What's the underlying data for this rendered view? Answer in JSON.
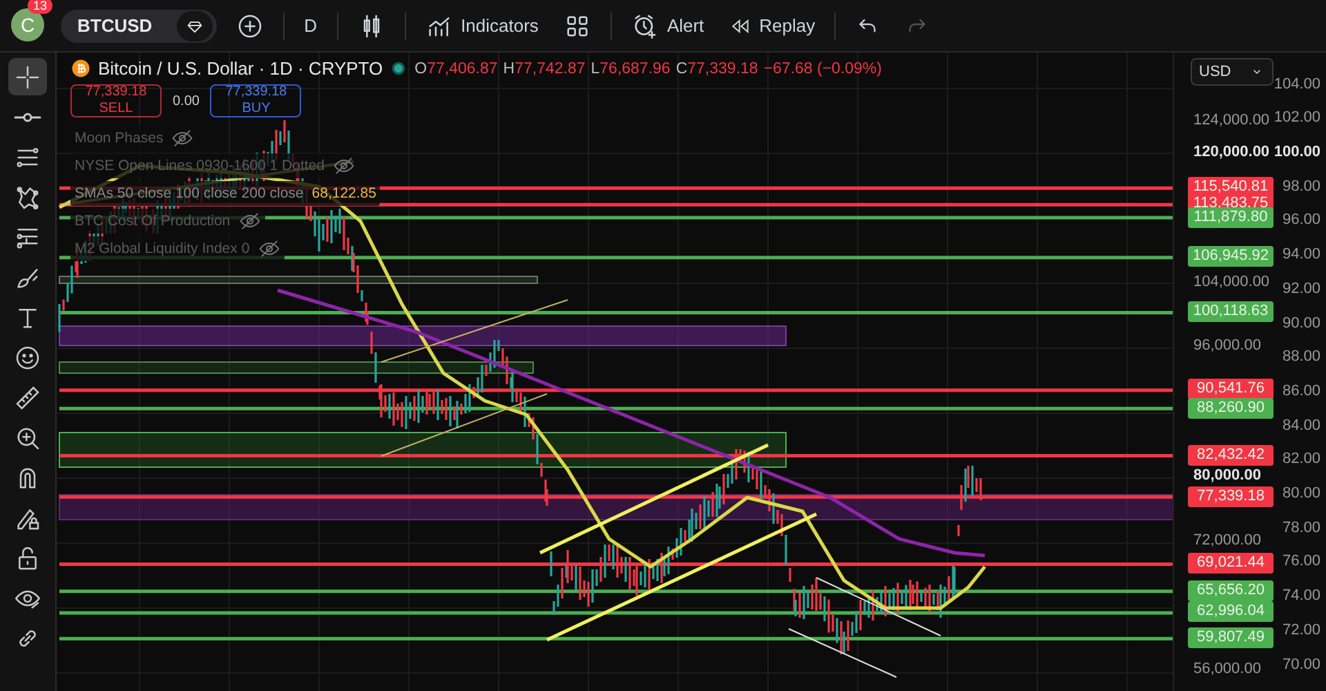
{
  "toolbar": {
    "avatar": "C",
    "badge": "13",
    "symbol": "BTCUSD",
    "interval": "D",
    "indicators": "Indicators",
    "alert": "Alert",
    "replay": "Replay",
    "redo_disabled": true
  },
  "tools": [
    {
      "kind": "crosshair",
      "selected": true
    },
    {
      "kind": "hline",
      "selected": false
    },
    {
      "kind": "channel",
      "selected": false
    },
    {
      "kind": "pattern",
      "selected": false
    },
    {
      "kind": "fib",
      "selected": false
    },
    {
      "kind": "brush",
      "selected": false
    },
    {
      "kind": "text",
      "selected": false
    },
    {
      "kind": "smiley",
      "selected": false
    },
    {
      "kind": "ruler",
      "selected": false
    },
    {
      "kind": "zoom",
      "selected": false
    },
    {
      "kind": "magnet",
      "selected": false
    },
    {
      "kind": "pencil-lock",
      "selected": false
    },
    {
      "kind": "lock",
      "selected": false
    },
    {
      "kind": "eye",
      "selected": false
    },
    {
      "kind": "link",
      "selected": false
    }
  ],
  "legend": {
    "title": "Bitcoin / U.S. Dollar · 1D · CRYPTO",
    "ohlc": [
      {
        "label": "O",
        "value": "77,406.87"
      },
      {
        "label": "H",
        "value": "77,742.87"
      },
      {
        "label": "L",
        "value": "76,687.96"
      },
      {
        "label": "C",
        "value": "77,339.18"
      }
    ],
    "change": "−67.68 (−0.09%)"
  },
  "trade": {
    "sell_price": "77,339.18",
    "sell_label": "SELL",
    "spread": "0.00",
    "buy_price": "77,339.18",
    "buy_label": "BUY"
  },
  "indicators": [
    {
      "name": "Moon Phases",
      "hidden": true
    },
    {
      "name": "NYSE Open Lines 0930-1600 1 Dotted",
      "hidden": true
    },
    {
      "name": "SMAs 50 close 100 close 200 close",
      "value": "68,122.85",
      "hidden": false
    },
    {
      "name": "BTC Cost Of Production",
      "hidden": true
    },
    {
      "name": "M2 Global Liquidity Index 0",
      "hidden": true
    }
  ],
  "currency": "USD",
  "price_axis": {
    "ticks": [
      {
        "label": "124,000.00",
        "strong": false
      },
      {
        "label": "120,000.00",
        "strong": true
      },
      {
        "label": "104,000.00",
        "strong": false
      },
      {
        "label": "96,000.00",
        "strong": false
      },
      {
        "label": "80,000.00",
        "strong": true
      },
      {
        "label": "72,000.00",
        "strong": false
      },
      {
        "label": "56,000.00",
        "strong": false
      }
    ],
    "levels": [
      {
        "label": "115,540.81",
        "color": "#f23645"
      },
      {
        "label": "113,483.75",
        "color": "#f23645"
      },
      {
        "label": "111,879.80",
        "color": "#4caf50"
      },
      {
        "label": "106,945.92",
        "color": "#4caf50"
      },
      {
        "label": "100,118.63",
        "color": "#4caf50"
      },
      {
        "label": "90,541.76",
        "color": "#f23645"
      },
      {
        "label": "88,260.90",
        "color": "#4caf50"
      },
      {
        "label": "82,432.42",
        "color": "#f23645"
      },
      {
        "label": "77,339.18",
        "color": "#f23645"
      },
      {
        "label": "69,021.44",
        "color": "#f23645"
      },
      {
        "label": "65,656.20",
        "color": "#4caf50"
      },
      {
        "label": "62,996.04",
        "color": "#4caf50"
      },
      {
        "label": "59,807.49",
        "color": "#4caf50"
      }
    ]
  },
  "percent_axis": {
    "ticks": [
      {
        "label": "104.00",
        "strong": false
      },
      {
        "label": "102.00",
        "strong": false
      },
      {
        "label": "100.00",
        "strong": true
      },
      {
        "label": "98.00",
        "strong": false
      },
      {
        "label": "96.00",
        "strong": false
      },
      {
        "label": "94.00",
        "strong": false
      },
      {
        "label": "92.00",
        "strong": false
      },
      {
        "label": "90.00",
        "strong": false
      },
      {
        "label": "88.00",
        "strong": false
      },
      {
        "label": "86.00",
        "strong": false
      },
      {
        "label": "84.00",
        "strong": false
      },
      {
        "label": "82.00",
        "strong": false
      },
      {
        "label": "80.00",
        "strong": false
      },
      {
        "label": "78.00",
        "strong": false
      },
      {
        "label": "76.00",
        "strong": false
      },
      {
        "label": "74.00",
        "strong": false
      },
      {
        "label": "72.00",
        "strong": false
      },
      {
        "label": "70.00",
        "strong": false
      }
    ]
  }
}
